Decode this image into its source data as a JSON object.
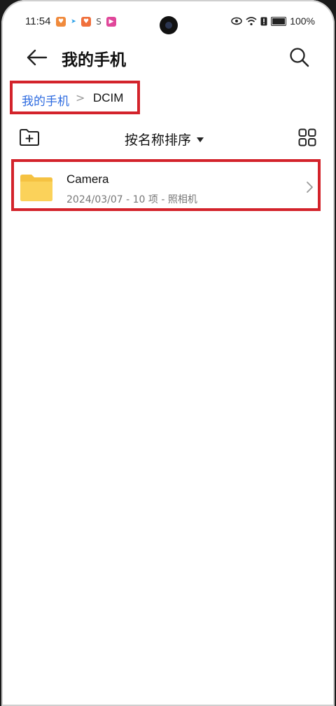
{
  "status_bar": {
    "time": "11:54",
    "battery": "100%",
    "colors": {
      "accent_blue": "#2d6be0",
      "highlight_red": "#d3232b",
      "folder_yellow": "#fbd25a"
    }
  },
  "header": {
    "title": "我的手机"
  },
  "breadcrumb": {
    "root": "我的手机",
    "separator": ">",
    "current": "DCIM"
  },
  "toolbar": {
    "sort_label": "按名称排序"
  },
  "files": [
    {
      "name": "Camera",
      "meta": "2024/03/07 - 10 项 - 照相机",
      "icon": "folder-icon"
    }
  ]
}
